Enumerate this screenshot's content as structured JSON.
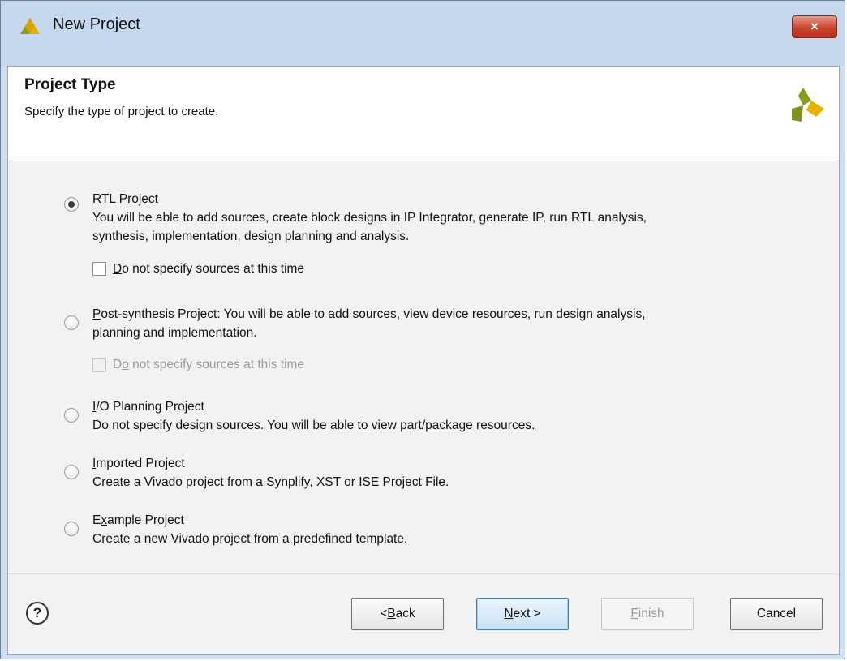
{
  "window": {
    "title": "New Project",
    "close_label": "×"
  },
  "header": {
    "title": "Project Type",
    "subtitle": "Specify the type of project to create."
  },
  "options": [
    {
      "name": "RTL Project",
      "mnemonic": "R",
      "rest": "TL Project",
      "description_line1": "You will be able to add sources, create block designs in IP Integrator, generate IP, run RTL analysis,",
      "description_line2": "synthesis, implementation, design planning and analysis.",
      "selected": true,
      "checkbox": {
        "pre": "",
        "mn": "D",
        "post": "o not specify sources at this time",
        "checked": false,
        "enabled": true
      }
    },
    {
      "mnemonic": "P",
      "rest": "ost-synthesis Project: You will be able to add sources, view device resources, run design analysis,",
      "line2": "planning and implementation.",
      "selected": false,
      "checkbox": {
        "pre": "D",
        "mn": "o",
        "post": " not specify sources at this time",
        "checked": false,
        "enabled": false
      }
    },
    {
      "mnemonic": "I",
      "rest": "/O Planning Project",
      "description": "Do not specify design sources. You will be able to view part/package resources.",
      "selected": false
    },
    {
      "mnemonic": "I",
      "rest": "mported Project",
      "description": "Create a Vivado project from a Synplify, XST or ISE Project File.",
      "selected": false
    },
    {
      "pre": "E",
      "mnemonic": "x",
      "rest": "ample Project",
      "description": "Create a new Vivado project from a predefined template.",
      "selected": false
    }
  ],
  "footer": {
    "help": "?",
    "back": {
      "pre": "< ",
      "mn": "B",
      "post": "ack"
    },
    "next": {
      "mn": "N",
      "post": "ext >"
    },
    "finish": {
      "mn": "F",
      "post": "inish"
    },
    "cancel": "Cancel"
  },
  "colors": {
    "title_bar": "#c5d8ed",
    "close_button": "#c9442f",
    "logo_green": "#8a9e1e",
    "logo_yellow": "#e8b100"
  }
}
